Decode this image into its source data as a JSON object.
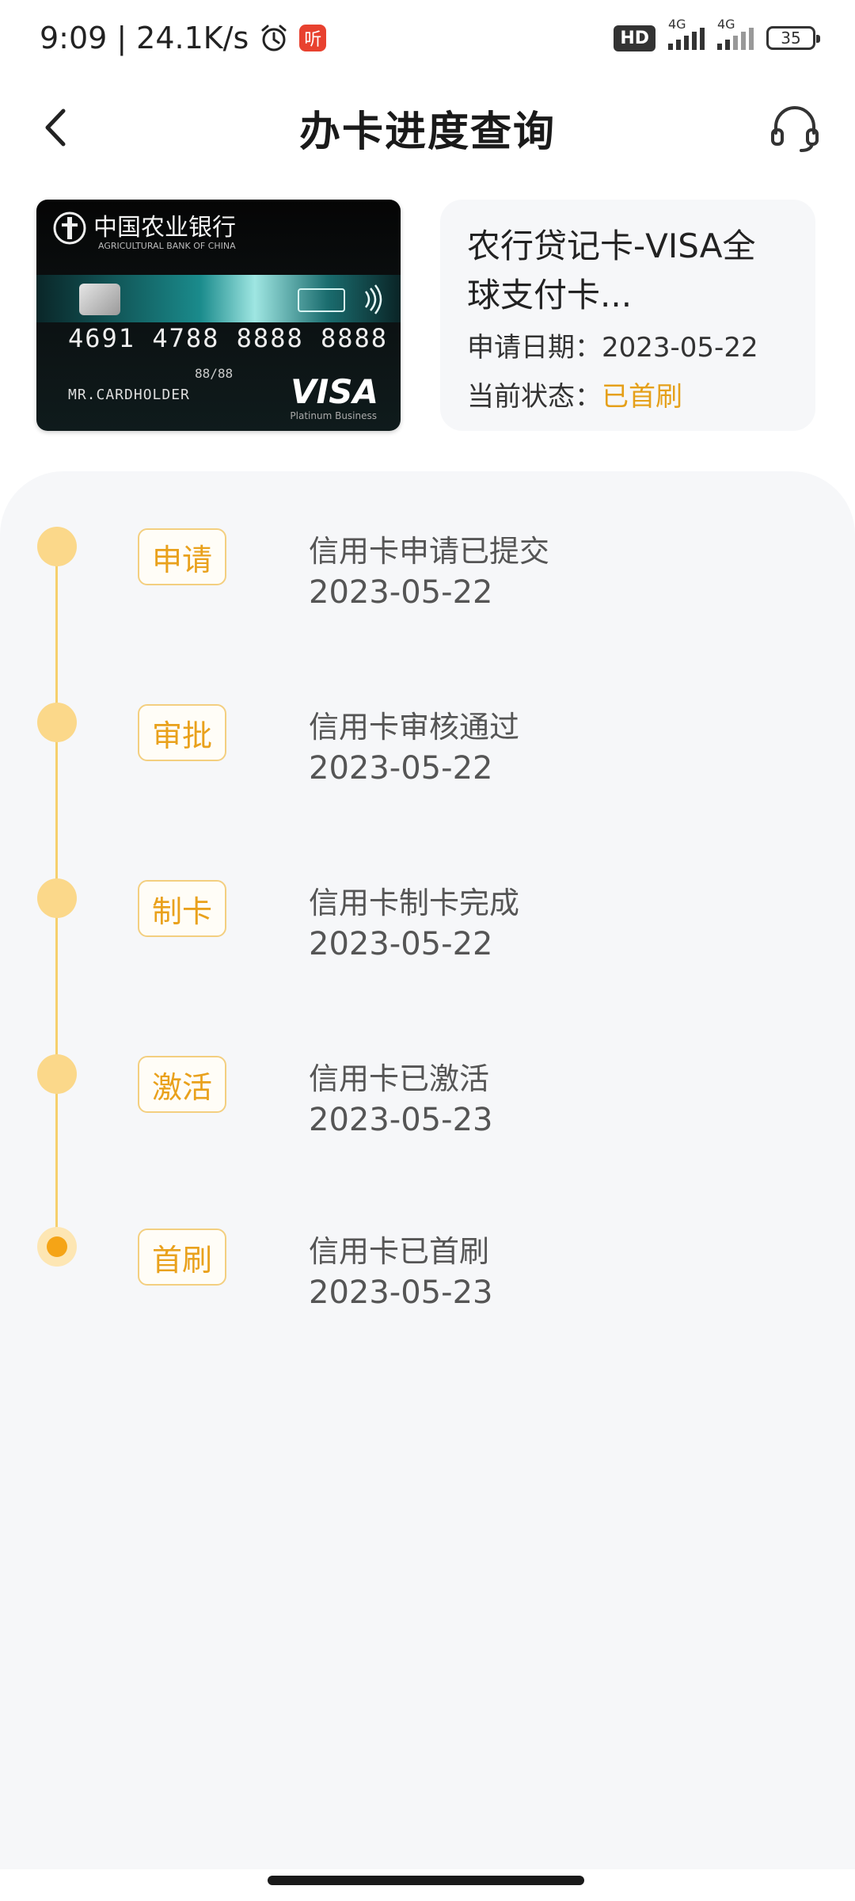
{
  "status_bar": {
    "time": "9:09",
    "speed": "24.1K/s",
    "listen_label": "听",
    "hd_label": "HD",
    "network1": "4G",
    "network2": "4G",
    "battery": "35"
  },
  "header": {
    "title": "办卡进度查询"
  },
  "card": {
    "image": {
      "bank_name": "中国农业银行",
      "bank_name_en": "AGRICULTURAL BANK OF CHINA",
      "number": "4691 4788 8888 8888",
      "valid": "88/88",
      "holder": "MR.CARDHOLDER",
      "brand": "VISA",
      "brand_sub": "Platinum Business"
    },
    "name": "农行贷记卡-VISA全球支付卡...",
    "apply_date_label": "申请日期：",
    "apply_date": "2023-05-22",
    "status_label": "当前状态：",
    "status": "已首刷",
    "status_color": "#e5a01a"
  },
  "timeline": {
    "accent_color": "#f5a416",
    "steps": [
      {
        "tag": "申请",
        "title": "信用卡申请已提交",
        "date": "2023-05-22"
      },
      {
        "tag": "审批",
        "title": "信用卡审核通过",
        "date": "2023-05-22"
      },
      {
        "tag": "制卡",
        "title": "信用卡制卡完成",
        "date": "2023-05-22"
      },
      {
        "tag": "激活",
        "title": "信用卡已激活",
        "date": "2023-05-23"
      },
      {
        "tag": "首刷",
        "title": "信用卡已首刷",
        "date": "2023-05-23"
      }
    ]
  }
}
